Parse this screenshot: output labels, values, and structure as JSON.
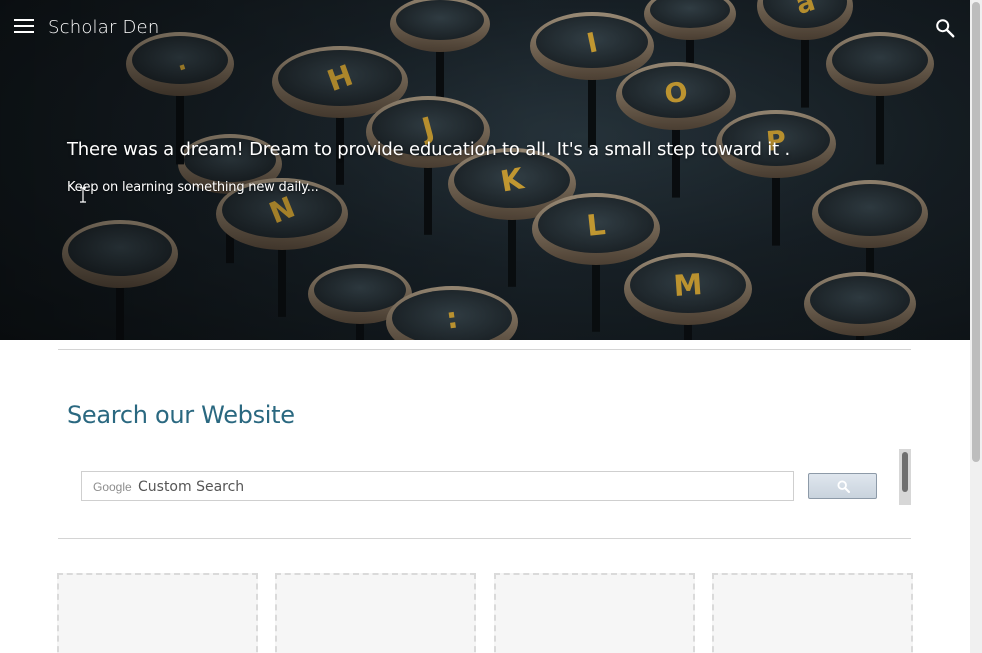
{
  "header": {
    "site_title": "Scholar Den"
  },
  "hero": {
    "headline": "There was a dream! Dream to provide education to all. It's a small step toward it .",
    "subline": "Keep on learning something new daily...",
    "key_letters": [
      "a",
      "I",
      "H",
      "O",
      "J",
      "P",
      "K",
      "N",
      "L",
      "M",
      ":",
      "."
    ]
  },
  "search_section": {
    "heading": "Search our Website",
    "google_label": "Google",
    "placeholder": "Custom Search"
  },
  "colors": {
    "heading": "#2a6880",
    "key_letter": "#e6b43a",
    "button": "#c9d3dd"
  },
  "icons": {
    "menu": "menu-icon",
    "search": "search-icon",
    "magnifier": "magnifier-icon"
  }
}
